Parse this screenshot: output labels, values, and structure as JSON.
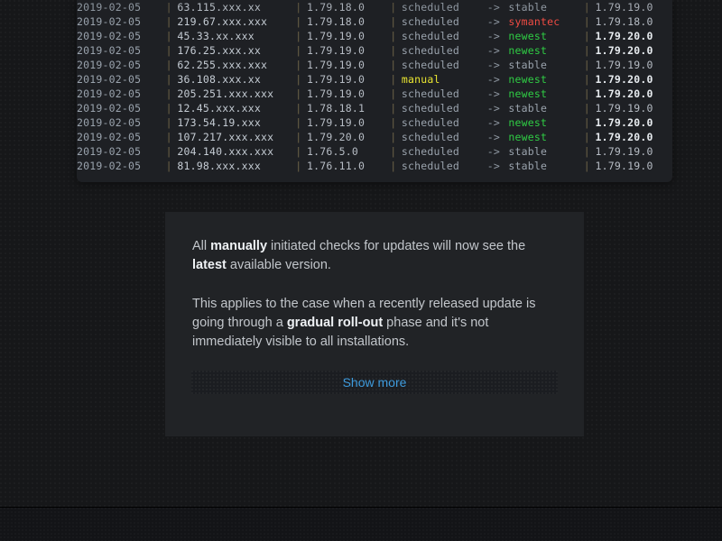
{
  "log_panel": {
    "rows": [
      {
        "date": "2019-02-05",
        "ip": "63.115.xxx.xx",
        "version": "1.79.18.0",
        "type": "scheduled",
        "arrow": "->",
        "channel": "stable",
        "latest": "1.79.19.0",
        "channel_style": "stable",
        "latest_highlight": false,
        "partial": true
      },
      {
        "date": "2019-02-05",
        "ip": "219.67.xxx.xxx",
        "version": "1.79.18.0",
        "type": "scheduled",
        "arrow": "->",
        "channel": "symantec",
        "latest": "1.79.18.0",
        "channel_style": "symantec",
        "latest_highlight": false,
        "partial": false
      },
      {
        "date": "2019-02-05",
        "ip": "45.33.xx.xxx",
        "version": "1.79.19.0",
        "type": "scheduled",
        "arrow": "->",
        "channel": "newest",
        "latest": "1.79.20.0",
        "channel_style": "newest",
        "latest_highlight": true,
        "partial": false
      },
      {
        "date": "2019-02-05",
        "ip": "176.25.xxx.xx",
        "version": "1.79.19.0",
        "type": "scheduled",
        "arrow": "->",
        "channel": "newest",
        "latest": "1.79.20.0",
        "channel_style": "newest",
        "latest_highlight": true,
        "partial": false
      },
      {
        "date": "2019-02-05",
        "ip": "62.255.xxx.xxx",
        "version": "1.79.19.0",
        "type": "scheduled",
        "arrow": "->",
        "channel": "stable",
        "latest": "1.79.19.0",
        "channel_style": "stable",
        "latest_highlight": false,
        "partial": false
      },
      {
        "date": "2019-02-05",
        "ip": "36.108.xxx.xx",
        "version": "1.79.19.0",
        "type": "manual",
        "arrow": "->",
        "channel": "newest",
        "latest": "1.79.20.0",
        "channel_style": "newest",
        "latest_highlight": true,
        "partial": false,
        "type_style": "manual"
      },
      {
        "date": "2019-02-05",
        "ip": "205.251.xxx.xxx",
        "version": "1.79.19.0",
        "type": "scheduled",
        "arrow": "->",
        "channel": "newest",
        "latest": "1.79.20.0",
        "channel_style": "newest",
        "latest_highlight": true,
        "partial": false
      },
      {
        "date": "2019-02-05",
        "ip": "12.45.xxx.xxx",
        "version": "1.78.18.1",
        "type": "scheduled",
        "arrow": "->",
        "channel": "stable",
        "latest": "1.79.19.0",
        "channel_style": "stable",
        "latest_highlight": false,
        "partial": false
      },
      {
        "date": "2019-02-05",
        "ip": "173.54.19.xxx",
        "version": "1.79.19.0",
        "type": "scheduled",
        "arrow": "->",
        "channel": "newest",
        "latest": "1.79.20.0",
        "channel_style": "newest",
        "latest_highlight": true,
        "partial": false
      },
      {
        "date": "2019-02-05",
        "ip": "107.217.xxx.xxx",
        "version": "1.79.20.0",
        "type": "scheduled",
        "arrow": "->",
        "channel": "newest",
        "latest": "1.79.20.0",
        "channel_style": "newest",
        "latest_highlight": true,
        "partial": false
      },
      {
        "date": "2019-02-05",
        "ip": "204.140.xxx.xxx",
        "version": "1.76.5.0",
        "type": "scheduled",
        "arrow": "->",
        "channel": "stable",
        "latest": "1.79.19.0",
        "channel_style": "stable",
        "latest_highlight": false,
        "partial": false
      },
      {
        "date": "2019-02-05",
        "ip": "81.98.xxx.xxx",
        "version": "1.76.11.0",
        "type": "scheduled",
        "arrow": "->",
        "channel": "stable",
        "latest": "1.79.19.0",
        "channel_style": "stable",
        "latest_highlight": false,
        "partial": false
      }
    ],
    "separator": "|"
  },
  "info_card": {
    "paragraph_1": {
      "part_1": "All ",
      "bold_1": "manually",
      "part_2": " initiated checks for updates will now see the ",
      "bold_2": "latest",
      "part_3": " available version."
    },
    "paragraph_2": {
      "part_1": "This applies to the case when a recently released update is going through a ",
      "bold_1": "gradual roll-out",
      "part_2": " phase and it's not immediately visible to all installations."
    },
    "show_more_label": "Show more"
  },
  "colors": {
    "page_background": "#161719",
    "panel_background": "#1e2024",
    "card_background": "#212326",
    "link": "#3e9bdd",
    "channel_newest": "#2fcc44",
    "channel_symantec": "#ef4b43",
    "channel_manual": "#e9e531",
    "channel_stable": "#9aa3ad",
    "separator": "#6e6348"
  }
}
